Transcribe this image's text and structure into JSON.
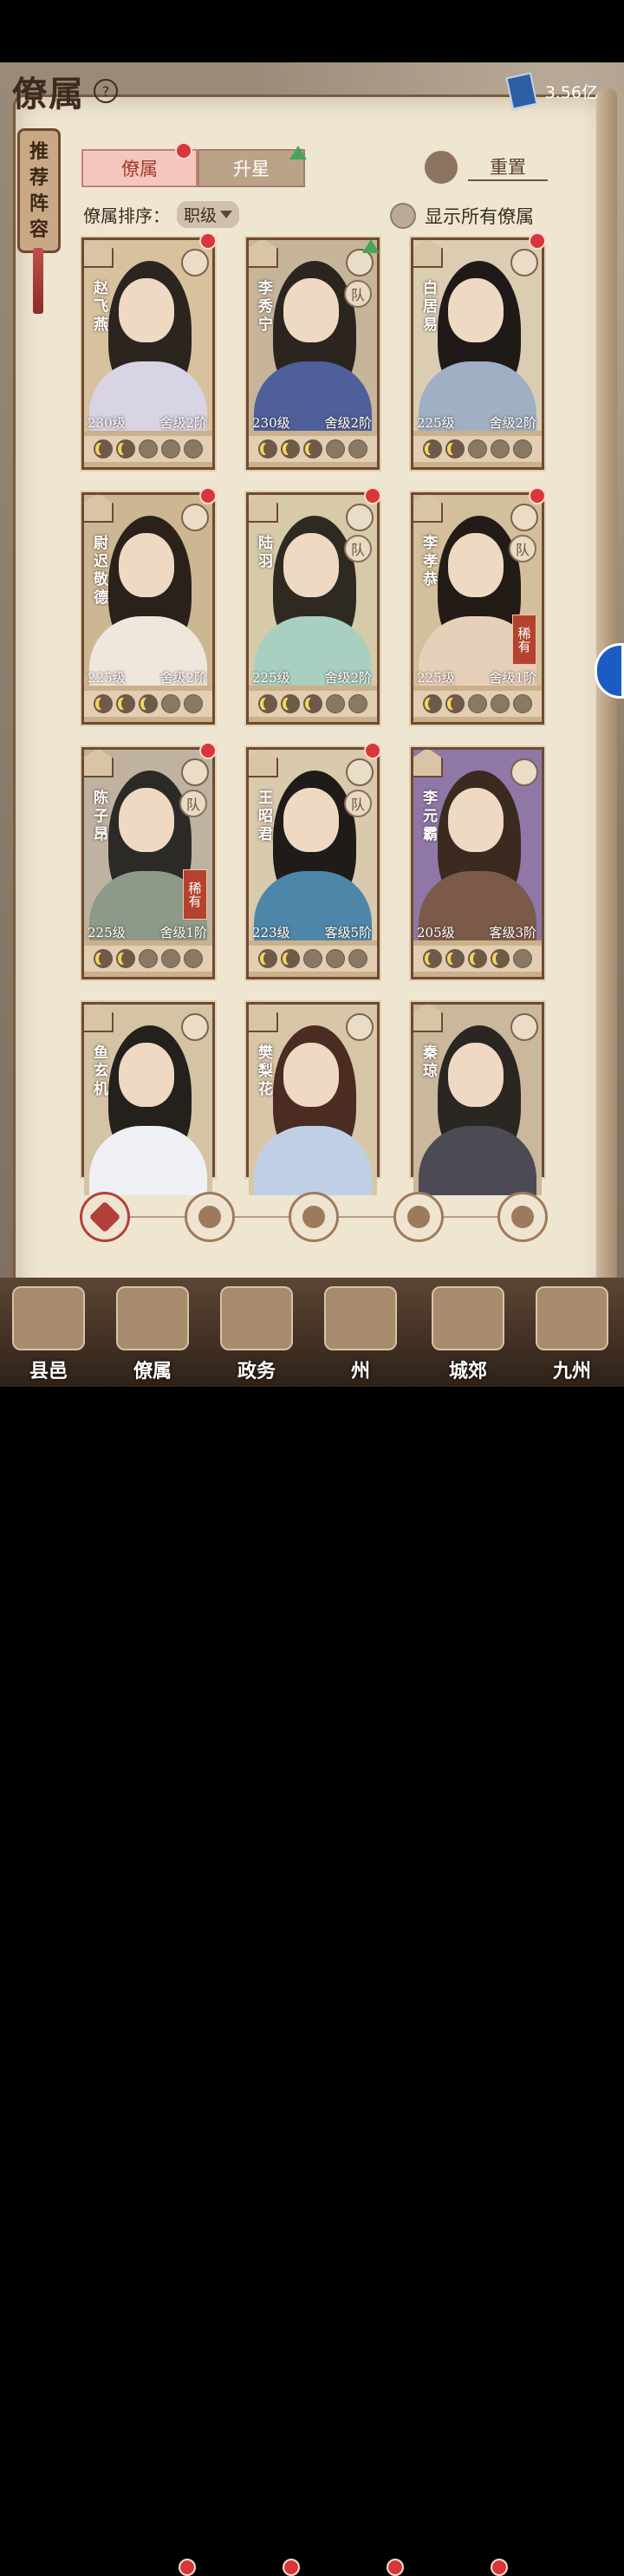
{
  "header": {
    "title": "僚属",
    "help_glyph": "?",
    "currency_value": "3.56亿"
  },
  "recommend_banner": {
    "label": "推荐阵容",
    "chars": [
      "推",
      "荐",
      "阵",
      "容"
    ]
  },
  "tabs": {
    "retainers": "僚属",
    "star_up": "升星"
  },
  "reset": {
    "label": "重置"
  },
  "sort": {
    "label": "僚属排序：",
    "value": "职级"
  },
  "show_all": {
    "label": "显示所有僚属"
  },
  "cards": [
    {
      "name": "赵飞燕",
      "level": "230级",
      "rank": "舍级2阶",
      "stars_on": 2,
      "stars_total": 5,
      "red_dot": true,
      "badge": ""
    },
    {
      "name": "李秀宁",
      "level": "230级",
      "rank": "舍级2阶",
      "stars_on": 3,
      "stars_total": 5,
      "red_dot": false,
      "badge": "队",
      "arrow": true
    },
    {
      "name": "白居易",
      "level": "225级",
      "rank": "舍级2阶",
      "stars_on": 2,
      "stars_total": 5,
      "red_dot": true,
      "badge": ""
    },
    {
      "name": "尉迟敬德",
      "level": "225级",
      "rank": "舍级2阶",
      "stars_on": 3,
      "stars_total": 5,
      "red_dot": true,
      "badge": ""
    },
    {
      "name": "陆羽",
      "level": "225级",
      "rank": "舍级2阶",
      "stars_on": 3,
      "stars_total": 5,
      "red_dot": true,
      "badge": "队"
    },
    {
      "name": "李孝恭",
      "level": "225级",
      "rank": "舍级1阶",
      "stars_on": 2,
      "stars_total": 5,
      "red_dot": true,
      "badge": "队",
      "rare": "稀有"
    },
    {
      "name": "陈子昂",
      "level": "225级",
      "rank": "舍级1阶",
      "stars_on": 2,
      "stars_total": 5,
      "red_dot": true,
      "badge": "队",
      "rare": "稀有"
    },
    {
      "name": "王昭君",
      "level": "223级",
      "rank": "客级5阶",
      "stars_on": 2,
      "stars_total": 5,
      "red_dot": true,
      "badge": "队"
    },
    {
      "name": "李元霸",
      "level": "205级",
      "rank": "客级3阶",
      "stars_on": 4,
      "stars_total": 5,
      "red_dot": false,
      "badge": ""
    },
    {
      "name": "鱼玄机",
      "level": "",
      "rank": "",
      "stars_on": 0,
      "stars_total": 0,
      "red_dot": false,
      "badge": ""
    },
    {
      "name": "樊梨花",
      "level": "",
      "rank": "",
      "stars_on": 0,
      "stars_total": 0,
      "red_dot": false,
      "badge": ""
    },
    {
      "name": "秦琼",
      "level": "",
      "rank": "",
      "stars_on": 0,
      "stars_total": 0,
      "red_dot": false,
      "badge": ""
    }
  ],
  "filters": [
    "all-filter-icon",
    "bell-icon",
    "gourd-icon",
    "fan-icon",
    "lion-icon"
  ],
  "nav": [
    {
      "label": "县邑",
      "red_dot": false
    },
    {
      "label": "僚属",
      "red_dot": true
    },
    {
      "label": "政务",
      "red_dot": true
    },
    {
      "label": "州",
      "red_dot": true
    },
    {
      "label": "城郊",
      "red_dot": true
    },
    {
      "label": "九州",
      "red_dot": false
    }
  ],
  "colors": {
    "accent": "#b33f3a",
    "paper": "#efe6d2",
    "frame": "#6e4a30",
    "rare": "#b3432f"
  }
}
